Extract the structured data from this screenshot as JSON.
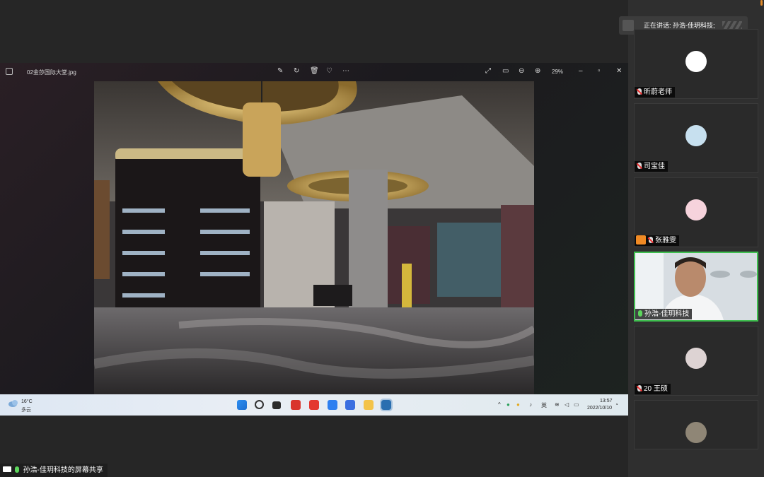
{
  "viewer": {
    "filename": "02金莎国际大堂.jpg",
    "zoom": "29%",
    "icons": [
      "edit-icon",
      "rotate-icon",
      "delete-icon",
      "favorite-icon",
      "more-icon",
      "fullscreen-icon",
      "slideshow-icon",
      "zoom-out-icon",
      "zoom-in-icon",
      "minimize-icon",
      "maximize-icon",
      "close-icon"
    ]
  },
  "taskbar": {
    "weather_temp": "16°C",
    "weather_desc": "多云",
    "ime": "英",
    "time": "13:57",
    "date": "2022/10/10"
  },
  "share": {
    "label": "孙浩-佳玥科技的屏幕共享"
  },
  "speaking": {
    "label": "正在讲话: 孙浩-佳玥科技;"
  },
  "participants": [
    {
      "name": "昕蔚老师"
    },
    {
      "name": "司宝佳"
    },
    {
      "name": "张雅雯"
    },
    {
      "name": "孙浩-佳玥科技"
    },
    {
      "name": "20 王硕"
    },
    {
      "name": ""
    }
  ]
}
